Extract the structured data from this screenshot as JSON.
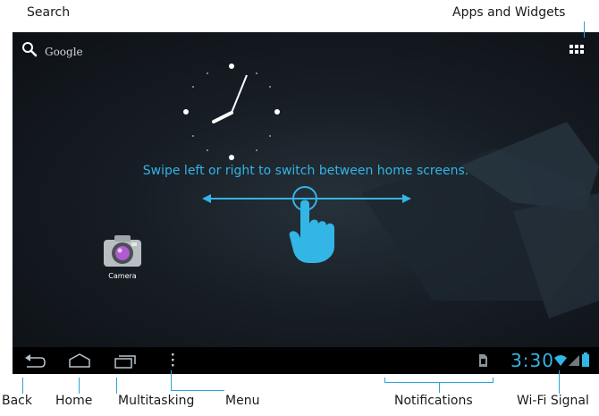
{
  "callouts": {
    "search": "Search",
    "apps_widgets": "Apps and Widgets",
    "back": "Back",
    "home": "Home",
    "multitasking": "Multitasking",
    "menu": "Menu",
    "notifications": "Notifications",
    "wifi_signal": "Wi-Fi Signal"
  },
  "search_bar": {
    "label": "Google",
    "icon": "search-icon"
  },
  "apps_button": {
    "icon": "apps-grid-icon"
  },
  "hint": {
    "text": "Swipe left or right to switch between home screens."
  },
  "camera_app": {
    "label": "Camera",
    "icon": "camera-icon"
  },
  "status": {
    "time": "3:30"
  },
  "colors": {
    "accent": "#33b5e5",
    "wallpaper": "#171d24",
    "navbar": "#000000",
    "leader": "#2aa4d8"
  }
}
